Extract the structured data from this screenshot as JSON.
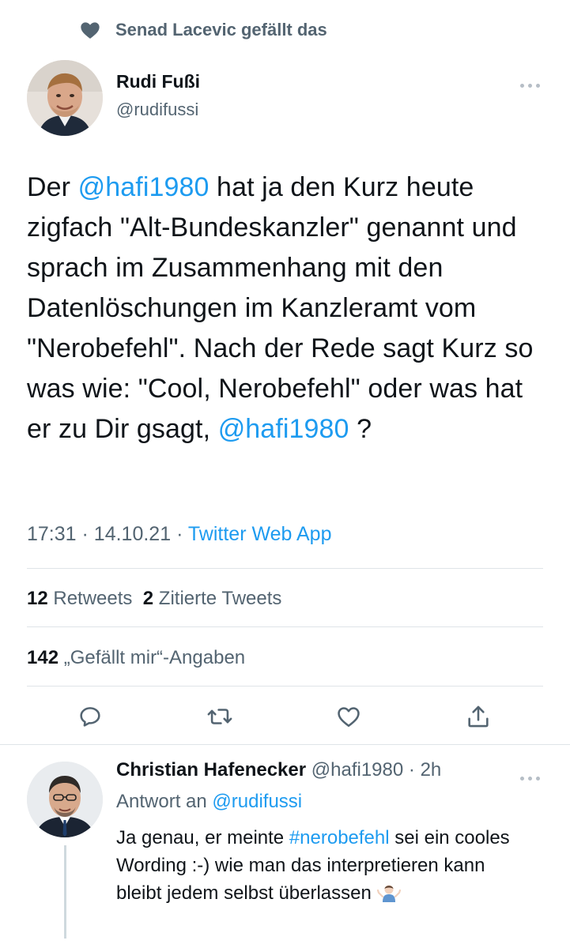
{
  "social_context": {
    "text": "Senad Lacevic gefällt das",
    "icon": "heart-icon"
  },
  "tweet": {
    "author_name": "Rudi Fußi",
    "author_handle": "@rudifussi",
    "body": {
      "p1": "Der ",
      "mention1": "@hafi1980",
      "p2": " hat ja den Kurz heute zigfach \"Alt-Bundeskanzler\" genannt und sprach im Zusammenhang mit den Datenlöschungen im Kanzleramt vom \"Nerobefehl\". Nach der Rede sagt Kurz so was wie: \"Cool, Nerobefehl\" oder was hat er zu Dir gsagt, ",
      "mention2": "@hafi1980",
      "p3": " ?"
    },
    "time": "17:31",
    "date": "14.10.21",
    "separator": "·",
    "source": "Twitter Web App",
    "retweets_count": "12",
    "retweets_label": "Retweets",
    "quotes_count": "2",
    "quotes_label": "Zitierte Tweets",
    "likes_count": "142",
    "likes_label": "„Gefällt mir“-Angaben"
  },
  "actions": [
    "reply-icon",
    "retweet-icon",
    "like-icon",
    "share-icon"
  ],
  "reply": {
    "author_name": "Christian Hafenecker",
    "author_handle": "@hafi1980",
    "separator": "·",
    "age": "2h",
    "reply_to_prefix": "Antwort an ",
    "reply_to_handle": "@rudifussi",
    "body_p1": "Ja genau, er meinte ",
    "hashtag": "#nerobefehl",
    "body_p2": " sei ein cooles Wording :-) wie man das interpretieren kann bleibt jedem selbst überlassen",
    "emoji": "person-shrugging-emoji"
  },
  "colors": {
    "accent": "#1d9bf0",
    "text": "#0f1419",
    "muted": "#536471",
    "divider": "#dfe4e8"
  }
}
